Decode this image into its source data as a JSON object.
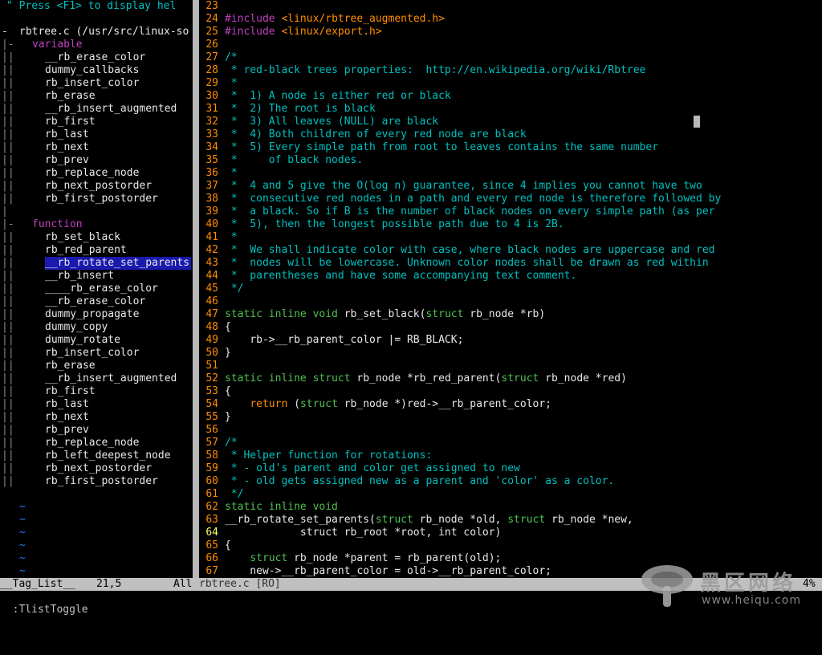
{
  "taglist": {
    "help_line": "\" Press <F1> to display hel",
    "file_line": "rbtree.c (/usr/src/linux-so",
    "variable_header": "variable",
    "variables": [
      "__rb_erase_color",
      "dummy_callbacks",
      "rb_insert_color",
      "rb_erase",
      "__rb_insert_augmented",
      "rb_first",
      "rb_last",
      "rb_next",
      "rb_prev",
      "rb_replace_node",
      "rb_next_postorder",
      "rb_first_postorder"
    ],
    "function_header": "function",
    "functions": [
      "rb_set_black",
      "rb_red_parent",
      "__rb_rotate_set_parents",
      "__rb_insert",
      "____rb_erase_color",
      "__rb_erase_color",
      "dummy_propagate",
      "dummy_copy",
      "dummy_rotate",
      "rb_insert_color",
      "rb_erase",
      "__rb_insert_augmented",
      "rb_first",
      "rb_last",
      "rb_next",
      "rb_prev",
      "rb_replace_node",
      "rb_left_deepest_node",
      "rb_next_postorder",
      "rb_first_postorder"
    ],
    "selected_function": "__rb_rotate_set_parents",
    "tilde": "~"
  },
  "code": {
    "lines": [
      {
        "n": "23",
        "segs": []
      },
      {
        "n": "24",
        "segs": [
          {
            "c": "purple",
            "t": "#include "
          },
          {
            "c": "orange",
            "t": "<linux/rbtree_augmented.h>"
          }
        ]
      },
      {
        "n": "25",
        "segs": [
          {
            "c": "purple",
            "t": "#include "
          },
          {
            "c": "orange",
            "t": "<linux/export.h>"
          }
        ]
      },
      {
        "n": "26",
        "segs": []
      },
      {
        "n": "27",
        "segs": [
          {
            "c": "cyan",
            "t": "/*"
          }
        ]
      },
      {
        "n": "28",
        "segs": [
          {
            "c": "cyan",
            "t": " * red-black trees properties:  http://en.wikipedia.org/wiki/Rbtree"
          }
        ]
      },
      {
        "n": "29",
        "segs": [
          {
            "c": "cyan",
            "t": " *"
          }
        ]
      },
      {
        "n": "30",
        "segs": [
          {
            "c": "cyan",
            "t": " *  1) A node is either red or black"
          }
        ]
      },
      {
        "n": "31",
        "segs": [
          {
            "c": "cyan",
            "t": " *  2) The root is black"
          }
        ]
      },
      {
        "n": "32",
        "segs": [
          {
            "c": "cyan",
            "t": " *  3) All leaves (NULL) are black"
          }
        ]
      },
      {
        "n": "33",
        "segs": [
          {
            "c": "cyan",
            "t": " *  4) Both children of every red node are black"
          }
        ]
      },
      {
        "n": "34",
        "segs": [
          {
            "c": "cyan",
            "t": " *  5) Every simple path from root to leaves contains the same number"
          }
        ]
      },
      {
        "n": "35",
        "segs": [
          {
            "c": "cyan",
            "t": " *     of black nodes."
          }
        ]
      },
      {
        "n": "36",
        "segs": [
          {
            "c": "cyan",
            "t": " *"
          }
        ]
      },
      {
        "n": "37",
        "segs": [
          {
            "c": "cyan",
            "t": " *  4 and 5 give the O(log n) guarantee, since 4 implies you cannot have two"
          }
        ]
      },
      {
        "n": "38",
        "segs": [
          {
            "c": "cyan",
            "t": " *  consecutive red nodes in a path and every red node is therefore followed by"
          }
        ]
      },
      {
        "n": "39",
        "segs": [
          {
            "c": "cyan",
            "t": " *  a black. So if B is the number of black nodes on every simple path (as per"
          }
        ]
      },
      {
        "n": "40",
        "segs": [
          {
            "c": "cyan",
            "t": " *  5), then the longest possible path due to 4 is 2B."
          }
        ]
      },
      {
        "n": "41",
        "segs": [
          {
            "c": "cyan",
            "t": " *"
          }
        ]
      },
      {
        "n": "42",
        "segs": [
          {
            "c": "cyan",
            "t": " *  We shall indicate color with case, where black nodes are uppercase and red"
          }
        ]
      },
      {
        "n": "43",
        "segs": [
          {
            "c": "cyan",
            "t": " *  nodes will be lowercase. Unknown color nodes shall be drawn as red within"
          }
        ]
      },
      {
        "n": "44",
        "segs": [
          {
            "c": "cyan",
            "t": " *  parentheses and have some accompanying text comment."
          }
        ]
      },
      {
        "n": "45",
        "segs": [
          {
            "c": "cyan",
            "t": " */"
          }
        ]
      },
      {
        "n": "46",
        "segs": []
      },
      {
        "n": "47",
        "segs": [
          {
            "c": "green",
            "t": "static inline void"
          },
          {
            "c": "white",
            "t": " rb_set_black("
          },
          {
            "c": "green",
            "t": "struct"
          },
          {
            "c": "white",
            "t": " rb_node *rb)"
          }
        ]
      },
      {
        "n": "48",
        "segs": [
          {
            "c": "white",
            "t": "{"
          }
        ]
      },
      {
        "n": "49",
        "segs": [
          {
            "c": "white",
            "t": "    rb->__rb_parent_color |= RB_BLACK;"
          }
        ]
      },
      {
        "n": "50",
        "segs": [
          {
            "c": "white",
            "t": "}"
          }
        ]
      },
      {
        "n": "51",
        "segs": []
      },
      {
        "n": "52",
        "segs": [
          {
            "c": "green",
            "t": "static inline struct"
          },
          {
            "c": "white",
            "t": " rb_node *rb_red_parent("
          },
          {
            "c": "green",
            "t": "struct"
          },
          {
            "c": "white",
            "t": " rb_node *red)"
          }
        ]
      },
      {
        "n": "53",
        "segs": [
          {
            "c": "white",
            "t": "{"
          }
        ]
      },
      {
        "n": "54",
        "segs": [
          {
            "c": "white",
            "t": "    "
          },
          {
            "c": "orange",
            "t": "return"
          },
          {
            "c": "white",
            "t": " ("
          },
          {
            "c": "green",
            "t": "struct"
          },
          {
            "c": "white",
            "t": " rb_node *)red->__rb_parent_color;"
          }
        ]
      },
      {
        "n": "55",
        "segs": [
          {
            "c": "white",
            "t": "}"
          }
        ]
      },
      {
        "n": "56",
        "segs": []
      },
      {
        "n": "57",
        "segs": [
          {
            "c": "cyan",
            "t": "/*"
          }
        ]
      },
      {
        "n": "58",
        "segs": [
          {
            "c": "cyan",
            "t": " * Helper function for rotations:"
          }
        ]
      },
      {
        "n": "59",
        "segs": [
          {
            "c": "cyan",
            "t": " * - old's parent and color get assigned to new"
          }
        ]
      },
      {
        "n": "60",
        "segs": [
          {
            "c": "cyan",
            "t": " * - old gets assigned new as a parent and 'color' as a color."
          }
        ]
      },
      {
        "n": "61",
        "segs": [
          {
            "c": "cyan",
            "t": " */"
          }
        ]
      },
      {
        "n": "62",
        "segs": [
          {
            "c": "green",
            "t": "static inline void"
          }
        ]
      },
      {
        "n": "63",
        "segs": [
          {
            "c": "white",
            "t": "__rb_rotate_set_parents("
          },
          {
            "c": "green",
            "t": "struct"
          },
          {
            "c": "white",
            "t": " rb_node *old, "
          },
          {
            "c": "green",
            "t": "struct"
          },
          {
            "c": "white",
            "t": " rb_node *new,"
          }
        ]
      },
      {
        "n": "64",
        "cur": true,
        "segs": [
          {
            "c": "white",
            "t": "            struct rb_root *root, int color)"
          }
        ]
      },
      {
        "n": "65",
        "segs": [
          {
            "c": "white",
            "t": "{"
          }
        ]
      },
      {
        "n": "66",
        "segs": [
          {
            "c": "white",
            "t": "    "
          },
          {
            "c": "green",
            "t": "struct"
          },
          {
            "c": "white",
            "t": " rb_node *parent = rb_parent(old);"
          }
        ]
      },
      {
        "n": "67",
        "segs": [
          {
            "c": "white",
            "t": "    new->__rb_parent_color = old->__rb_parent_color;"
          }
        ]
      }
    ]
  },
  "status": {
    "left": "__Tag_List__",
    "pos": "21,5",
    "all": "All",
    "file": "rbtree.c [RO]",
    "pct": "4%"
  },
  "cmdline": ":TlistToggle",
  "watermark": {
    "brand": "黑区网络",
    "url": "www.heiqu.com"
  }
}
